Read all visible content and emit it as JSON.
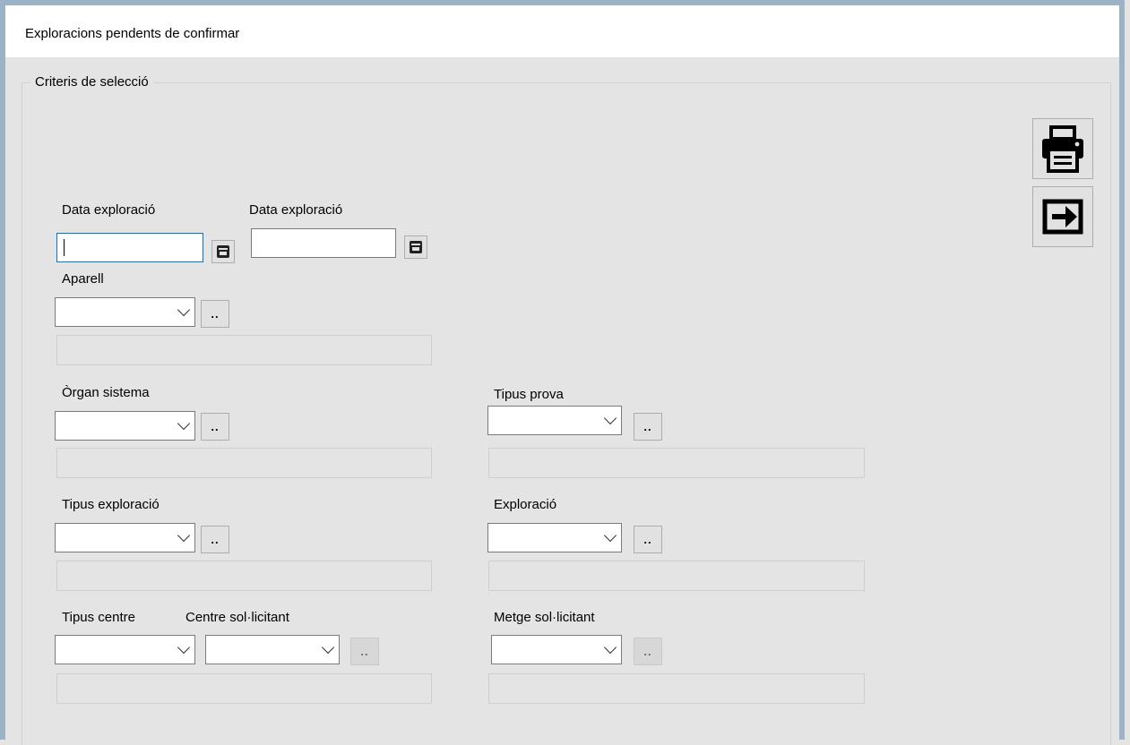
{
  "window": {
    "title": "Exploracions pendents de confirmar"
  },
  "groupbox": {
    "title": "Criteris de selecció"
  },
  "toolbar": {
    "print_icon": "printer-icon",
    "exit_icon": "exit-arrow-icon"
  },
  "fields": {
    "data_exploracio_from": {
      "label": "Data exploració",
      "value": ""
    },
    "data_exploracio_to": {
      "label": "Data exploració",
      "value": ""
    },
    "aparell": {
      "label": "Aparell",
      "value": "",
      "description": ""
    },
    "organ_sistema": {
      "label": "Òrgan sistema",
      "value": "",
      "description": ""
    },
    "tipus_prova": {
      "label": "Tipus prova",
      "value": "",
      "description": ""
    },
    "tipus_exploracio": {
      "label": "Tipus exploració",
      "value": "",
      "description": ""
    },
    "exploracio": {
      "label": "Exploració",
      "value": "",
      "description": ""
    },
    "tipus_centre": {
      "label": "Tipus centre",
      "value": ""
    },
    "centre_sollicitant": {
      "label": "Centre sol·licitant",
      "value": "",
      "description": ""
    },
    "metge_sollicitant": {
      "label": "Metge sol·licitant",
      "value": "",
      "description": ""
    }
  },
  "lookup_button_label": ".."
}
